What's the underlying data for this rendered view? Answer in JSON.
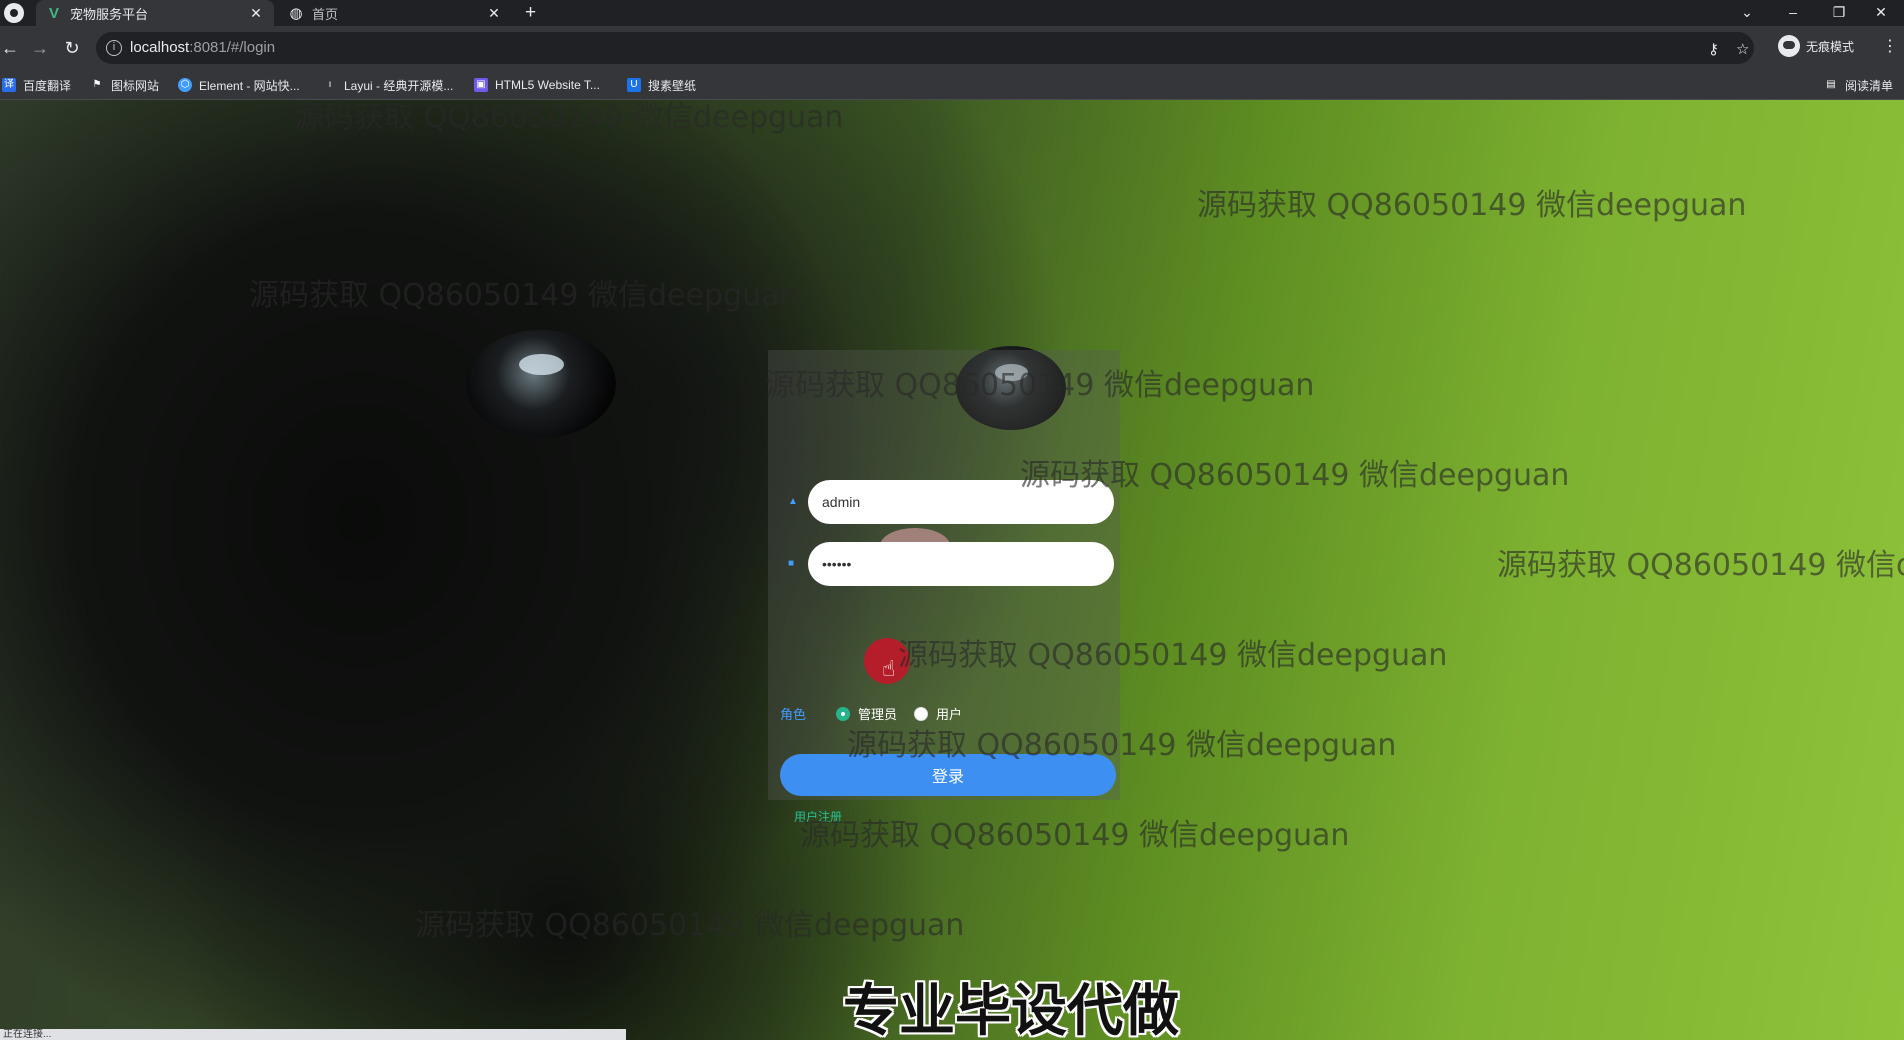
{
  "browser": {
    "tabs": [
      {
        "title": "宠物服务平台",
        "active": true
      },
      {
        "title": "首页",
        "active": false
      }
    ],
    "url_host": "localhost",
    "url_rest": ":8081/#/login",
    "profile_label": "无痕模式",
    "bookmarks": [
      "百度翻译",
      "图标网站",
      "Element - 网站快...",
      "Layui - 经典开源模...",
      "HTML5 Website T...",
      "搜素壁纸"
    ],
    "reading_list": "阅读清单",
    "status_text": "正在连接..."
  },
  "login": {
    "username_value": "admin",
    "password_value": "••••••",
    "role_label": "角色",
    "roles": [
      "管理员",
      "用户"
    ],
    "selected_role": "管理员",
    "login_button": "登录",
    "register_link": "用户注册"
  },
  "overlay": {
    "watermark": "源码获取 QQ86050149 微信deepguan",
    "watermark_cut": "源码获取 QQ86050149 微信d",
    "caption": "专业毕设代做"
  }
}
